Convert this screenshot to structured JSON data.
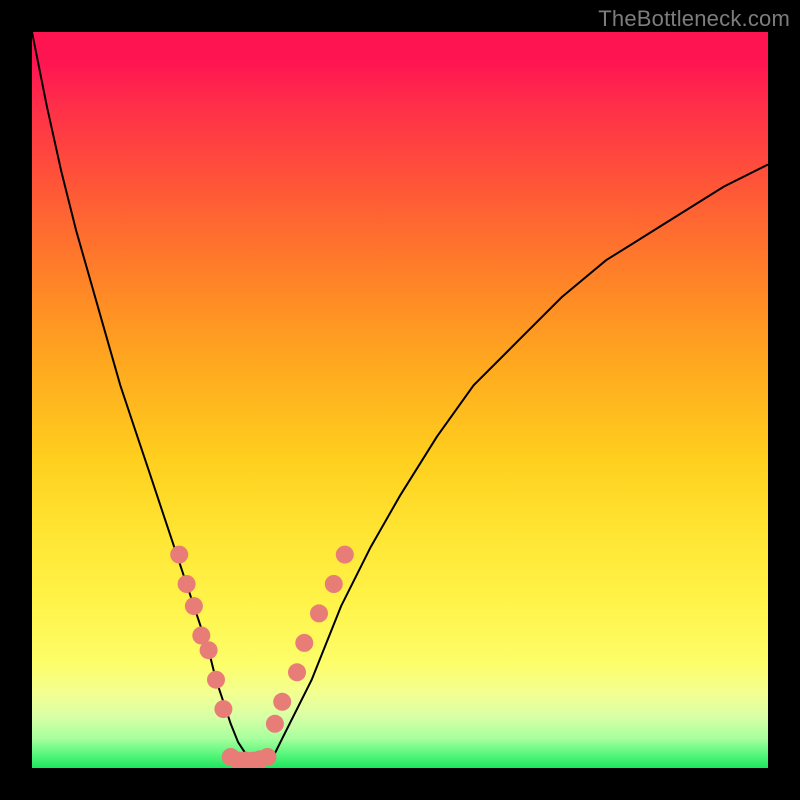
{
  "watermark": "TheBottleneck.com",
  "colors": {
    "frame": "#000000",
    "point_fill": "#e77d76",
    "curve_stroke": "#000000"
  },
  "chart_data": {
    "type": "line",
    "title": "",
    "xlabel": "",
    "ylabel": "",
    "xlim": [
      0,
      100
    ],
    "ylim": [
      0,
      100
    ],
    "x": [
      0,
      2,
      4,
      6,
      8,
      10,
      12,
      14,
      16,
      18,
      20,
      22,
      24,
      25,
      26,
      27,
      28,
      29,
      30,
      31,
      32,
      33,
      34,
      36,
      38,
      40,
      42,
      46,
      50,
      55,
      60,
      66,
      72,
      78,
      86,
      94,
      100
    ],
    "y": [
      100,
      90,
      81,
      73,
      66,
      59,
      52,
      46,
      40,
      34,
      28,
      22,
      16,
      12,
      9,
      6,
      3.5,
      2,
      1,
      1,
      1.2,
      2,
      4,
      8,
      12,
      17,
      22,
      30,
      37,
      45,
      52,
      58,
      64,
      69,
      74,
      79,
      82
    ],
    "points": [
      {
        "x": 20,
        "y": 29
      },
      {
        "x": 21,
        "y": 25
      },
      {
        "x": 22,
        "y": 22
      },
      {
        "x": 23,
        "y": 18
      },
      {
        "x": 24,
        "y": 16
      },
      {
        "x": 25,
        "y": 12
      },
      {
        "x": 26,
        "y": 8
      },
      {
        "x": 27,
        "y": 1.5
      },
      {
        "x": 28,
        "y": 1
      },
      {
        "x": 29,
        "y": 1
      },
      {
        "x": 30,
        "y": 1
      },
      {
        "x": 31,
        "y": 1.2
      },
      {
        "x": 32,
        "y": 1.5
      },
      {
        "x": 33,
        "y": 6
      },
      {
        "x": 34,
        "y": 9
      },
      {
        "x": 36,
        "y": 13
      },
      {
        "x": 37,
        "y": 17
      },
      {
        "x": 39,
        "y": 21
      },
      {
        "x": 41,
        "y": 25
      },
      {
        "x": 42.5,
        "y": 29
      }
    ]
  }
}
